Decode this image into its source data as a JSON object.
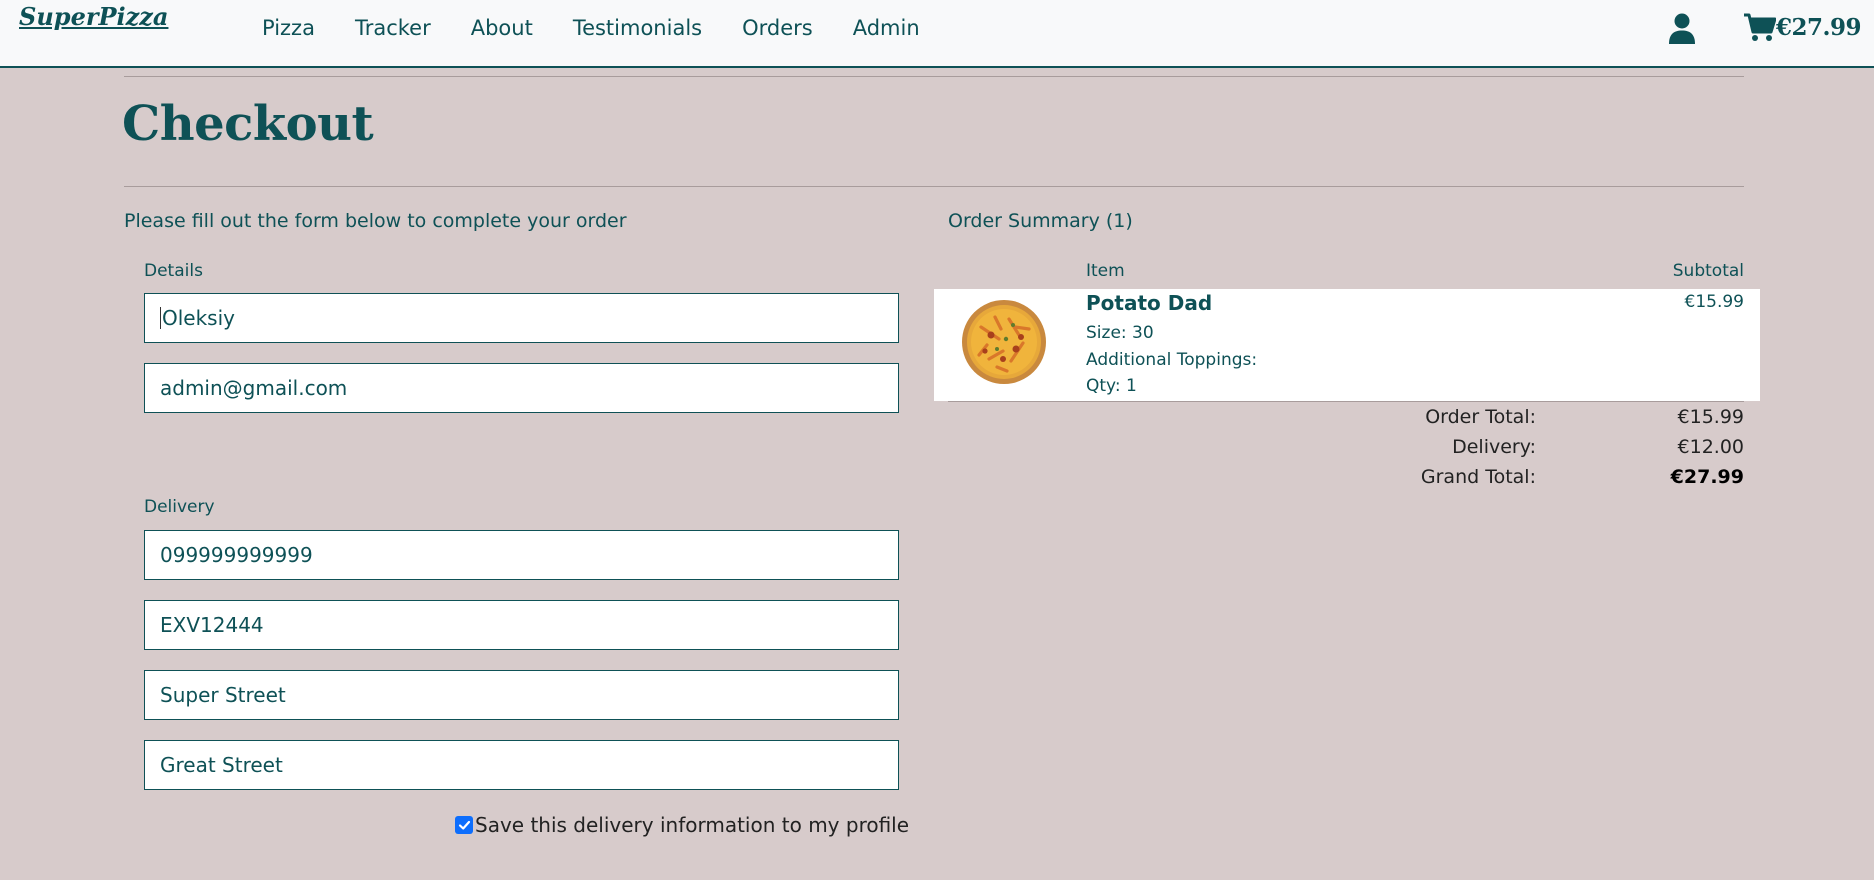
{
  "nav": {
    "brand": "SuperPizza",
    "links": [
      "Pizza",
      "Tracker",
      "About",
      "Testimonials",
      "Orders",
      "Admin"
    ],
    "cart_total": "€27.99",
    "icons": {
      "user": "user-icon",
      "cart": "cart-icon"
    }
  },
  "page": {
    "title": "Checkout",
    "form_intro": "Please fill out the form below to complete your order"
  },
  "form": {
    "details_legend": "Details",
    "full_name": "Oleksiy",
    "email": "admin@gmail.com",
    "delivery_legend": "Delivery",
    "phone": "099999999999",
    "postcode": "EXV12444",
    "street1": "Super Street",
    "street2": "Great Street",
    "save_info_checked": true,
    "save_info_label": "Save this delivery information to my profile"
  },
  "summary": {
    "title": "Order Summary (1)",
    "col_item": "Item",
    "col_subtotal": "Subtotal",
    "items": [
      {
        "name": "Potato Dad",
        "size": "Size: 30",
        "toppings": "Additional Toppings:",
        "qty": "Qty: 1",
        "price": "€15.99"
      }
    ],
    "order_total_label": "Order Total:",
    "order_total": "€15.99",
    "delivery_label": "Delivery:",
    "delivery": "€12.00",
    "grand_total_label": "Grand Total:",
    "grand_total": "€27.99"
  },
  "colors": {
    "primary": "#0e5156",
    "background": "#d7cbcb",
    "navbar": "#f8f9fa",
    "checkbox": "#0d6efd"
  }
}
